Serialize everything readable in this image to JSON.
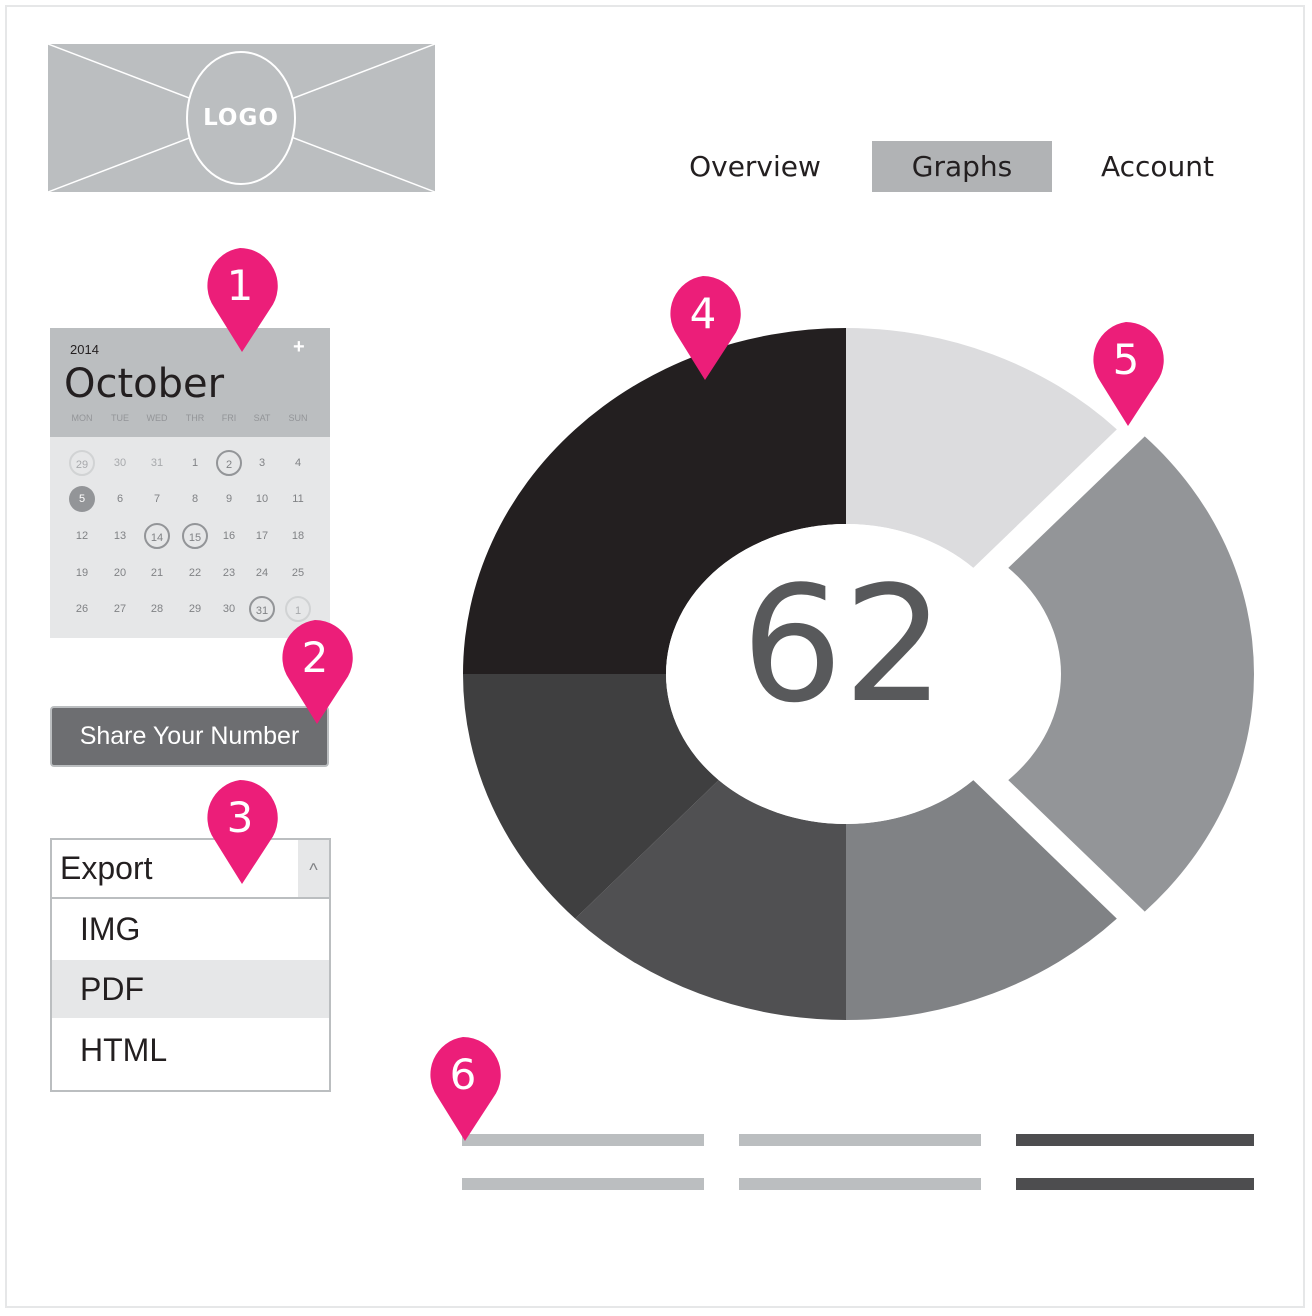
{
  "logo": {
    "text": "LOGO"
  },
  "nav": [
    {
      "label": "Overview",
      "active": false
    },
    {
      "label": "Graphs",
      "active": true
    },
    {
      "label": "Account",
      "active": false
    }
  ],
  "calendar": {
    "year": "2014",
    "month": "October",
    "add_icon": "plus-icon",
    "weekdays": [
      "MON",
      "TUE",
      "WED",
      "THR",
      "FRI",
      "SAT",
      "SUN"
    ],
    "weeks": [
      [
        "29",
        "30",
        "31",
        "1",
        "2",
        "3",
        "4"
      ],
      [
        "5",
        "6",
        "7",
        "8",
        "9",
        "10",
        "11"
      ],
      [
        "12",
        "13",
        "14",
        "15",
        "16",
        "17",
        "18"
      ],
      [
        "19",
        "20",
        "21",
        "22",
        "23",
        "24",
        "25"
      ],
      [
        "26",
        "27",
        "28",
        "29",
        "30",
        "31",
        "1"
      ]
    ]
  },
  "share_button": {
    "label": "Share Your Number"
  },
  "export": {
    "label": "Export",
    "caret_icon": "chevron-up-icon",
    "options": [
      "IMG",
      "PDF",
      "HTML"
    ],
    "highlighted": "PDF"
  },
  "markers": [
    "1",
    "2",
    "3",
    "4",
    "5",
    "6"
  ],
  "chart": {
    "center_value": "62"
  },
  "chart_data": {
    "type": "pie",
    "center_label": "62",
    "values": [
      12.5,
      25,
      12.5,
      12.5,
      12.5,
      25
    ],
    "colors": [
      "#dcdcde",
      "#939598",
      "#808285",
      "#505052",
      "#3f3f40",
      "#231f20"
    ],
    "exploded_index": 1
  },
  "colors": {
    "marker": "#ec1e79",
    "line_light": "#bbbec0",
    "line_dark": "#4d4d4f"
  }
}
